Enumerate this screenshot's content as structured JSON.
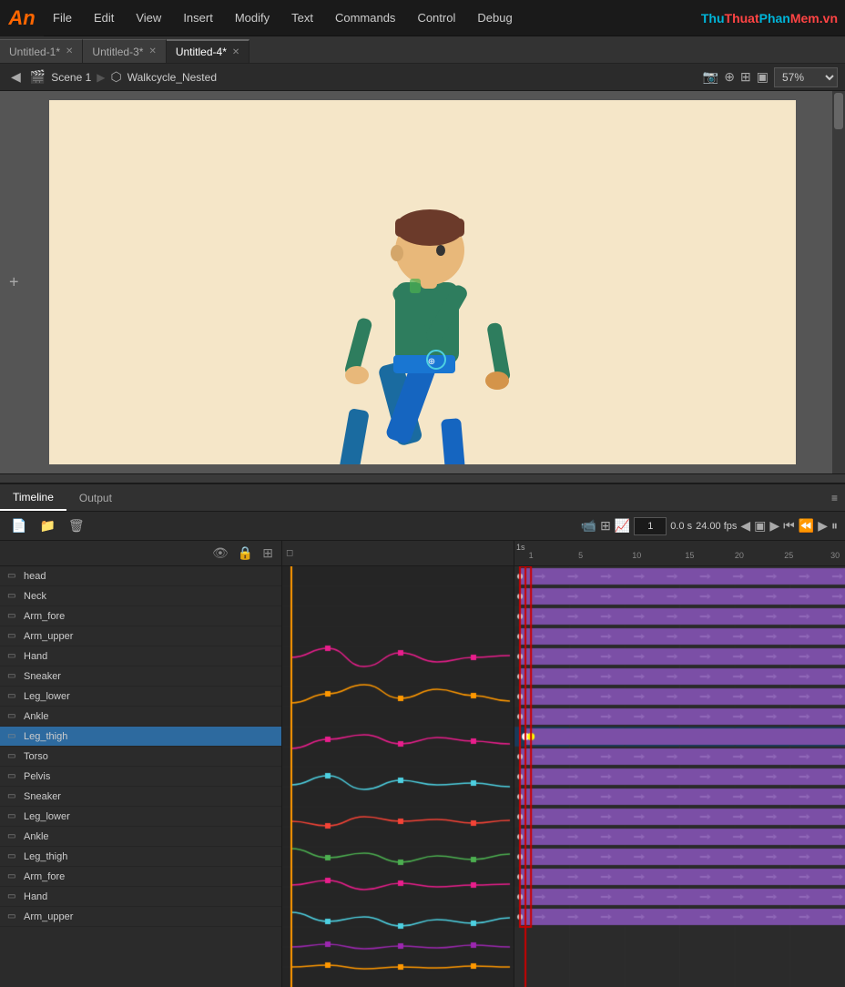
{
  "app": {
    "logo": "An",
    "watermark": "ThuThuatPhanMem.vn"
  },
  "menubar": {
    "items": [
      "File",
      "Edit",
      "View",
      "Insert",
      "Modify",
      "Text",
      "Commands",
      "Control",
      "Debug"
    ]
  },
  "tabs": [
    {
      "label": "Untitled-1*",
      "active": false
    },
    {
      "label": "Untitled-3*",
      "active": false
    },
    {
      "label": "Untitled-4*",
      "active": true
    }
  ],
  "scenebar": {
    "scene": "Scene 1",
    "symbol": "Walkcycle_Nested",
    "zoom": "57%"
  },
  "timeline": {
    "tabs": [
      "Timeline",
      "Output"
    ],
    "active_tab": "Timeline",
    "frame": "1",
    "time": "0.0 s",
    "fps": "24.00 fps",
    "seconds_label": "1s",
    "ruler_marks": [
      1,
      5,
      10,
      15,
      20,
      25,
      30
    ]
  },
  "layers": [
    {
      "name": "head",
      "selected": false
    },
    {
      "name": "Neck",
      "selected": false
    },
    {
      "name": "Arm_fore",
      "selected": false
    },
    {
      "name": "Arm_upper",
      "selected": false
    },
    {
      "name": "Hand",
      "selected": false
    },
    {
      "name": "Sneaker",
      "selected": false
    },
    {
      "name": "Leg_lower",
      "selected": false
    },
    {
      "name": "Ankle",
      "selected": false
    },
    {
      "name": "Leg_thigh",
      "selected": true
    },
    {
      "name": "Torso",
      "selected": false
    },
    {
      "name": "Pelvis",
      "selected": false
    },
    {
      "name": "Sneaker",
      "selected": false
    },
    {
      "name": "Leg_lower",
      "selected": false
    },
    {
      "name": "Ankle",
      "selected": false
    },
    {
      "name": "Leg_thigh",
      "selected": false
    },
    {
      "name": "Arm_fore",
      "selected": false
    },
    {
      "name": "Hand",
      "selected": false
    },
    {
      "name": "Arm_upper",
      "selected": false
    }
  ]
}
